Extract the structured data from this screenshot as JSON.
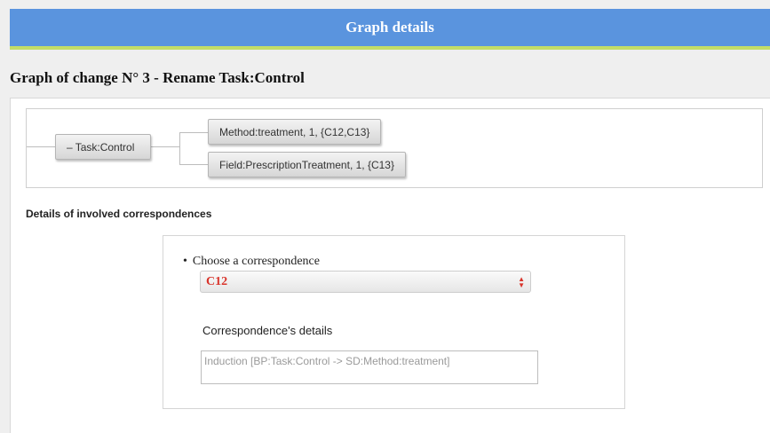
{
  "header": {
    "title": "Graph details"
  },
  "page": {
    "title": "Graph of change N° 3 - Rename Task:Control"
  },
  "graph": {
    "root": {
      "collapse_symbol": "–",
      "label": "Task:Control"
    },
    "children": [
      {
        "label": "Method:treatment, 1, {C12,C13}"
      },
      {
        "label": "Field:PrescriptionTreatment, 1, {C13}"
      }
    ]
  },
  "correspondences": {
    "section_title": "Details of involved correspondences",
    "choose_label": "Choose a correspondence",
    "selected": "C12",
    "details_label": "Correspondence's details",
    "details_value": "Induction [BP:Task:Control -> SD:Method:treatment]"
  },
  "colors": {
    "header_bg": "#5a94de",
    "header_accent": "#c3dd67",
    "select_text": "#d9332a"
  }
}
